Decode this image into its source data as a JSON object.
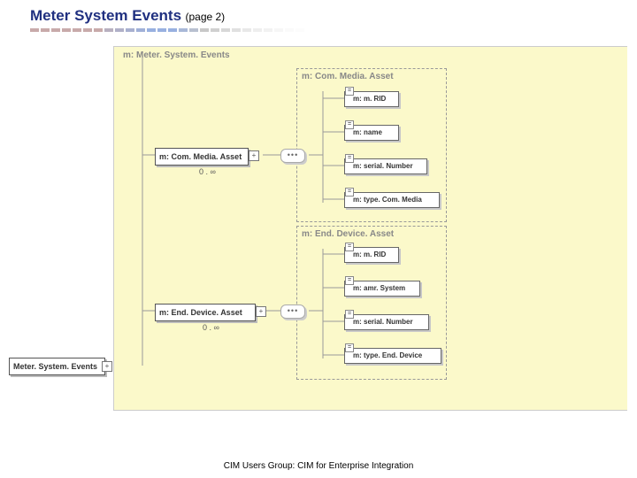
{
  "header": {
    "title": "Meter System Events",
    "page": "(page 2)"
  },
  "root": {
    "label": "Meter. System. Events"
  },
  "schema_root": {
    "label": "m: Meter. System. Events"
  },
  "group1": {
    "header": "m: Com. Media. Asset",
    "node": "m: Com. Media. Asset",
    "occurrence": "0 . ∞",
    "attrs": [
      "m: m. RID",
      "m: name",
      "m: serial. Number",
      "m: type. Com. Media"
    ]
  },
  "group2": {
    "header": "m: End. Device. Asset",
    "node": "m: End. Device. Asset",
    "occurrence": "0 . ∞",
    "attrs": [
      "m: m. RID",
      "m: amr. System",
      "m: serial. Number",
      "m: type. End. Device"
    ]
  },
  "footer": "CIM Users Group: CIM for Enterprise Integration",
  "colors": {
    "accent": "#203080",
    "canvas": "#fbf9ca"
  },
  "dash_colors": [
    "#c8aaaa",
    "#c8aaaa",
    "#c8aaaa",
    "#c8aaaa",
    "#c8aaaa",
    "#c8aaaa",
    "#c8aaaa",
    "#b8b0c0",
    "#b0b0c8",
    "#a8b0d0",
    "#a0b0d8",
    "#98b0e0",
    "#98b0e0",
    "#98b0e0",
    "#a8b8d8",
    "#b8c0d0",
    "#c8c8c8",
    "#d0d0d0",
    "#d8d8d8",
    "#e0e0e0",
    "#e8e8e8",
    "#eeeeee",
    "#f2f2f2",
    "#f6f6f6",
    "#fafafa",
    "#fcfcfc"
  ]
}
